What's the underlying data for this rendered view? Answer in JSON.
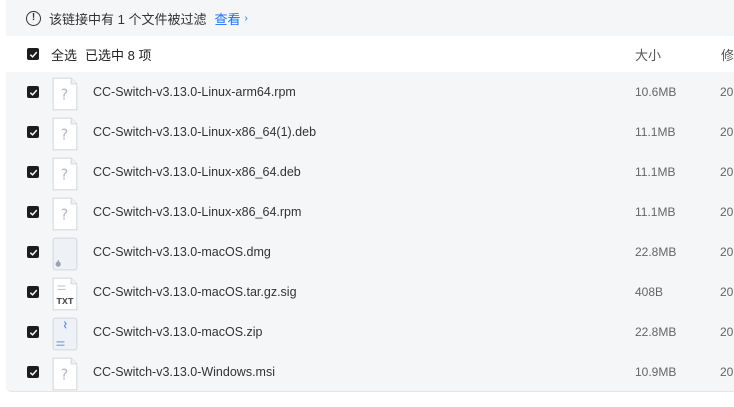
{
  "notice": {
    "text": "该链接中有 1 个文件被过滤",
    "link": "查看",
    "icon": "info-icon"
  },
  "header": {
    "select_all": "全选",
    "selected_count": "已选中  8  项",
    "col_size": "大小",
    "col_modified": "修"
  },
  "files": [
    {
      "name": "CC-Switch-v3.13.0-Linux-arm64.rpm",
      "size": "10.6MB",
      "modified": "20",
      "icon": "unknown-file-icon"
    },
    {
      "name": "CC-Switch-v3.13.0-Linux-x86_64(1).deb",
      "size": "11.1MB",
      "modified": "20",
      "icon": "unknown-file-icon"
    },
    {
      "name": "CC-Switch-v3.13.0-Linux-x86_64.deb",
      "size": "11.1MB",
      "modified": "20",
      "icon": "unknown-file-icon"
    },
    {
      "name": "CC-Switch-v3.13.0-Linux-x86_64.rpm",
      "size": "11.1MB",
      "modified": "20",
      "icon": "unknown-file-icon"
    },
    {
      "name": "CC-Switch-v3.13.0-macOS.dmg",
      "size": "22.8MB",
      "modified": "20",
      "icon": "apple-file-icon"
    },
    {
      "name": "CC-Switch-v3.13.0-macOS.tar.gz.sig",
      "size": "408B",
      "modified": "20",
      "icon": "txt-file-icon",
      "icon_label": "TXT"
    },
    {
      "name": "CC-Switch-v3.13.0-macOS.zip",
      "size": "22.8MB",
      "modified": "20",
      "icon": "zip-file-icon"
    },
    {
      "name": "CC-Switch-v3.13.0-Windows.msi",
      "size": "10.9MB",
      "modified": "20",
      "icon": "unknown-file-icon"
    }
  ]
}
